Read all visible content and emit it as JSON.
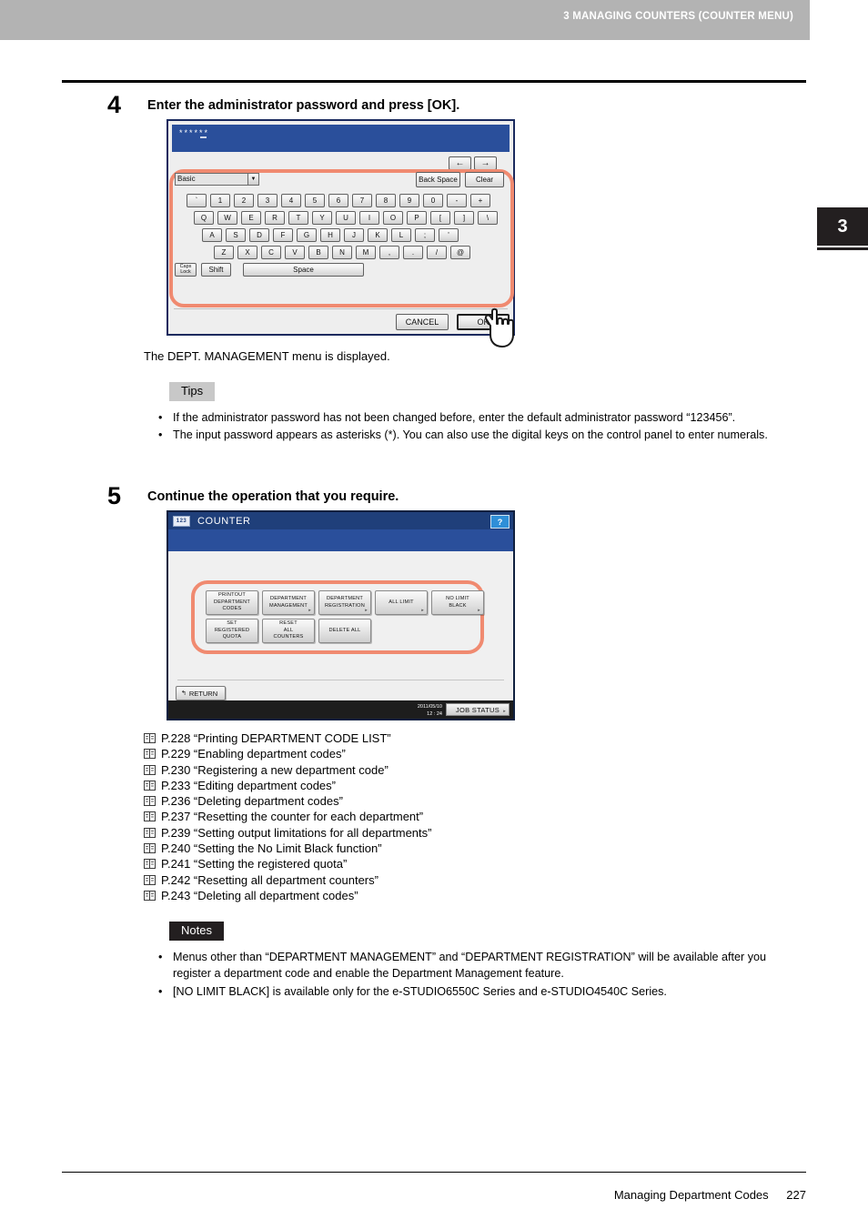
{
  "header": {
    "title": "3 MANAGING COUNTERS (COUNTER MENU)",
    "chapter_tab": "3"
  },
  "steps": [
    {
      "number": "4",
      "title": "Enter the administrator password and press [OK].",
      "result_text": "The DEPT. MANAGEMENT menu is displayed."
    },
    {
      "number": "5",
      "title": "Continue the operation that you require."
    }
  ],
  "keyboard_panel": {
    "password_value": "******",
    "arrow_left": "←",
    "arrow_right": "→",
    "language_select": "Basic",
    "select_arrow": "▼",
    "back_space_label": "Back Space",
    "clear_label": "Clear",
    "row1": [
      "`",
      "1",
      "2",
      "3",
      "4",
      "5",
      "6",
      "7",
      "8",
      "9",
      "0",
      "-",
      "+"
    ],
    "row2": [
      "Q",
      "W",
      "E",
      "R",
      "T",
      "Y",
      "U",
      "I",
      "O",
      "P",
      "[",
      "]",
      "\\"
    ],
    "row3": [
      "A",
      "S",
      "D",
      "F",
      "G",
      "H",
      "J",
      "K",
      "L",
      ";",
      "'"
    ],
    "row4": [
      "Z",
      "X",
      "C",
      "V",
      "B",
      "N",
      "M",
      ",",
      ".",
      "/",
      "@"
    ],
    "caps_lock_line1": "Caps",
    "caps_lock_line2": "Lock",
    "shift_label": "Shift",
    "space_label": "Space",
    "cancel_label": "CANCEL",
    "ok_label": "OK"
  },
  "counter_panel": {
    "icon_label": "123",
    "title": "COUNTER",
    "help_label": "?",
    "buttons": [
      {
        "label": "PRINTOUT\nDEPARTMENT\nCODES",
        "arrow": ""
      },
      {
        "label": "DEPARTMENT\nMANAGEMENT",
        "arrow": "▸"
      },
      {
        "label": "DEPARTMENT\nREGISTRATION",
        "arrow": "▸"
      },
      {
        "label": "ALL LIMIT",
        "arrow": "▸"
      },
      {
        "label": "NO LIMIT\nBLACK",
        "arrow": "▸"
      },
      {
        "label": "SET\nREGISTERED\nQUOTA",
        "arrow": ""
      },
      {
        "label": "RESET\nALL\nCOUNTERS",
        "arrow": ""
      },
      {
        "label": "DELETE ALL",
        "arrow": ""
      }
    ],
    "return_label": "RETURN",
    "return_icon": "↰",
    "date": "2011/05/10",
    "time": "12 : 24",
    "job_status_label": "JOB STATUS",
    "job_status_arrow": "▸"
  },
  "tips": {
    "label": "Tips",
    "items": [
      "If the administrator password has not been changed before, enter the default administrator password “123456”.",
      "The input password appears as asterisks (*). You can also use the digital keys on the control panel to enter numerals."
    ]
  },
  "xrefs": [
    "P.228 “Printing DEPARTMENT CODE LIST”",
    "P.229 “Enabling department codes”",
    "P.230 “Registering a new department code”",
    "P.233 “Editing department codes”",
    "P.236 “Deleting department codes”",
    "P.237 “Resetting the counter for each department”",
    "P.239 “Setting output limitations for all departments”",
    "P.240 “Setting the No Limit Black function”",
    "P.241 “Setting the registered quota”",
    "P.242 “Resetting all department counters”",
    "P.243 “Deleting all department codes”"
  ],
  "notes": {
    "label": "Notes",
    "items": [
      "Menus other than “DEPARTMENT MANAGEMENT” and “DEPARTMENT REGISTRATION” will be available after you register a department code and enable the Department Management feature.",
      "[NO LIMIT BLACK] is available only for the e-STUDIO6550C Series and e-STUDIO4540C Series."
    ]
  },
  "footer": {
    "section_title": "Managing Department Codes",
    "page_number": "227"
  }
}
